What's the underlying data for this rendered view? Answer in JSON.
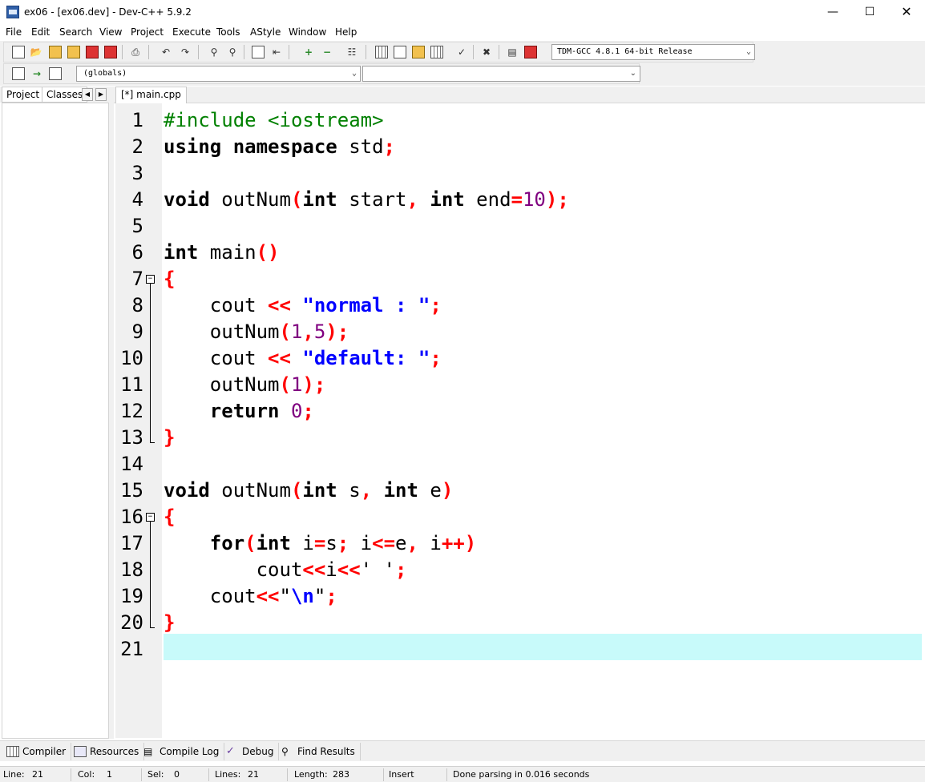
{
  "window": {
    "title": "ex06 - [ex06.dev] - Dev-C++ 5.9.2"
  },
  "menu": [
    "File",
    "Edit",
    "Search",
    "View",
    "Project",
    "Execute",
    "Tools",
    "AStyle",
    "Window",
    "Help"
  ],
  "toolbar": {
    "compiler": "TDM-GCC 4.8.1 64-bit Release",
    "scope": "(globals)",
    "member": ""
  },
  "left_tabs": {
    "project": "Project",
    "classes": "Classes"
  },
  "editor_tab": "[*] main.cpp",
  "code_lines": [
    {
      "n": "1",
      "tokens": [
        {
          "t": "#include <iostream>",
          "c": "pp"
        }
      ]
    },
    {
      "n": "2",
      "tokens": [
        {
          "t": "using",
          "c": "kw"
        },
        {
          "t": " ",
          "c": "id"
        },
        {
          "t": "namespace",
          "c": "kw"
        },
        {
          "t": " std",
          "c": "id"
        },
        {
          "t": ";",
          "c": "sym"
        }
      ]
    },
    {
      "n": "3",
      "tokens": []
    },
    {
      "n": "4",
      "tokens": [
        {
          "t": "void",
          "c": "kw"
        },
        {
          "t": " outNum",
          "c": "id"
        },
        {
          "t": "(",
          "c": "sym"
        },
        {
          "t": "int",
          "c": "kw"
        },
        {
          "t": " start",
          "c": "id"
        },
        {
          "t": ",",
          "c": "sym"
        },
        {
          "t": " ",
          "c": "id"
        },
        {
          "t": "int",
          "c": "kw"
        },
        {
          "t": " end",
          "c": "id"
        },
        {
          "t": "=",
          "c": "sym"
        },
        {
          "t": "10",
          "c": "num"
        },
        {
          "t": ");",
          "c": "sym"
        }
      ]
    },
    {
      "n": "5",
      "tokens": []
    },
    {
      "n": "6",
      "tokens": [
        {
          "t": "int",
          "c": "kw"
        },
        {
          "t": " main",
          "c": "id"
        },
        {
          "t": "()",
          "c": "sym"
        }
      ]
    },
    {
      "n": "7",
      "tokens": [
        {
          "t": "{",
          "c": "sym"
        }
      ]
    },
    {
      "n": "8",
      "tokens": [
        {
          "t": "    cout ",
          "c": "id"
        },
        {
          "t": "<<",
          "c": "sym"
        },
        {
          "t": " ",
          "c": "id"
        },
        {
          "t": "\"normal : \"",
          "c": "str"
        },
        {
          "t": ";",
          "c": "sym"
        }
      ]
    },
    {
      "n": "9",
      "tokens": [
        {
          "t": "    outNum",
          "c": "id"
        },
        {
          "t": "(",
          "c": "sym"
        },
        {
          "t": "1",
          "c": "num"
        },
        {
          "t": ",",
          "c": "sym"
        },
        {
          "t": "5",
          "c": "num"
        },
        {
          "t": ");",
          "c": "sym"
        }
      ]
    },
    {
      "n": "10",
      "tokens": [
        {
          "t": "    cout ",
          "c": "id"
        },
        {
          "t": "<<",
          "c": "sym"
        },
        {
          "t": " ",
          "c": "id"
        },
        {
          "t": "\"default: \"",
          "c": "str"
        },
        {
          "t": ";",
          "c": "sym"
        }
      ]
    },
    {
      "n": "11",
      "tokens": [
        {
          "t": "    outNum",
          "c": "id"
        },
        {
          "t": "(",
          "c": "sym"
        },
        {
          "t": "1",
          "c": "num"
        },
        {
          "t": ");",
          "c": "sym"
        }
      ]
    },
    {
      "n": "12",
      "tokens": [
        {
          "t": "    ",
          "c": "id"
        },
        {
          "t": "return",
          "c": "kw"
        },
        {
          "t": " ",
          "c": "id"
        },
        {
          "t": "0",
          "c": "num"
        },
        {
          "t": ";",
          "c": "sym"
        }
      ]
    },
    {
      "n": "13",
      "tokens": [
        {
          "t": "}",
          "c": "sym"
        }
      ]
    },
    {
      "n": "14",
      "tokens": []
    },
    {
      "n": "15",
      "tokens": [
        {
          "t": "void",
          "c": "kw"
        },
        {
          "t": " outNum",
          "c": "id"
        },
        {
          "t": "(",
          "c": "sym"
        },
        {
          "t": "int",
          "c": "kw"
        },
        {
          "t": " s",
          "c": "id"
        },
        {
          "t": ",",
          "c": "sym"
        },
        {
          "t": " ",
          "c": "id"
        },
        {
          "t": "int",
          "c": "kw"
        },
        {
          "t": " e",
          "c": "id"
        },
        {
          "t": ")",
          "c": "sym"
        }
      ]
    },
    {
      "n": "16",
      "tokens": [
        {
          "t": "{",
          "c": "sym"
        }
      ]
    },
    {
      "n": "17",
      "tokens": [
        {
          "t": "    ",
          "c": "id"
        },
        {
          "t": "for",
          "c": "kw"
        },
        {
          "t": "(",
          "c": "sym"
        },
        {
          "t": "int",
          "c": "kw"
        },
        {
          "t": " i",
          "c": "id"
        },
        {
          "t": "=",
          "c": "sym"
        },
        {
          "t": "s",
          "c": "id"
        },
        {
          "t": ";",
          "c": "sym"
        },
        {
          "t": " i",
          "c": "id"
        },
        {
          "t": "<=",
          "c": "sym"
        },
        {
          "t": "e",
          "c": "id"
        },
        {
          "t": ",",
          "c": "sym"
        },
        {
          "t": " i",
          "c": "id"
        },
        {
          "t": "++)",
          "c": "sym"
        }
      ]
    },
    {
      "n": "18",
      "tokens": [
        {
          "t": "        cout",
          "c": "id"
        },
        {
          "t": "<<",
          "c": "sym"
        },
        {
          "t": "i",
          "c": "id"
        },
        {
          "t": "<<",
          "c": "sym"
        },
        {
          "t": "' '",
          "c": "id"
        },
        {
          "t": ";",
          "c": "sym"
        }
      ]
    },
    {
      "n": "19",
      "tokens": [
        {
          "t": "    cout",
          "c": "id"
        },
        {
          "t": "<<",
          "c": "sym"
        },
        {
          "t": "\"",
          "c": "id"
        },
        {
          "t": "\\n",
          "c": "esc"
        },
        {
          "t": "\"",
          "c": "id"
        },
        {
          "t": ";",
          "c": "sym"
        }
      ]
    },
    {
      "n": "20",
      "tokens": [
        {
          "t": "}",
          "c": "sym"
        }
      ]
    },
    {
      "n": "21",
      "tokens": []
    }
  ],
  "bottom_tabs": [
    "Compiler",
    "Resources",
    "Compile Log",
    "Debug",
    "Find Results"
  ],
  "status": {
    "line_label": "Line:",
    "line_value": "21",
    "col_label": "Col:",
    "col_value": "1",
    "sel_label": "Sel:",
    "sel_value": "0",
    "lines_label": "Lines:",
    "lines_value": "21",
    "length_label": "Length:",
    "length_value": "283",
    "mode": "Insert",
    "message": "Done parsing in 0.016 seconds"
  }
}
